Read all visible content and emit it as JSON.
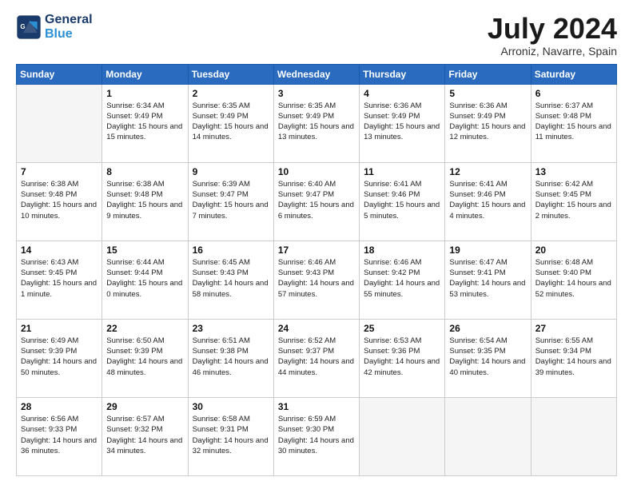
{
  "header": {
    "logo_line1": "General",
    "logo_line2": "Blue",
    "month_title": "July 2024",
    "location": "Arroniz, Navarre, Spain"
  },
  "days_of_week": [
    "Sunday",
    "Monday",
    "Tuesday",
    "Wednesday",
    "Thursday",
    "Friday",
    "Saturday"
  ],
  "weeks": [
    [
      {
        "day": "",
        "sunrise": "",
        "sunset": "",
        "daylight": ""
      },
      {
        "day": "1",
        "sunrise": "Sunrise: 6:34 AM",
        "sunset": "Sunset: 9:49 PM",
        "daylight": "Daylight: 15 hours and 15 minutes."
      },
      {
        "day": "2",
        "sunrise": "Sunrise: 6:35 AM",
        "sunset": "Sunset: 9:49 PM",
        "daylight": "Daylight: 15 hours and 14 minutes."
      },
      {
        "day": "3",
        "sunrise": "Sunrise: 6:35 AM",
        "sunset": "Sunset: 9:49 PM",
        "daylight": "Daylight: 15 hours and 13 minutes."
      },
      {
        "day": "4",
        "sunrise": "Sunrise: 6:36 AM",
        "sunset": "Sunset: 9:49 PM",
        "daylight": "Daylight: 15 hours and 13 minutes."
      },
      {
        "day": "5",
        "sunrise": "Sunrise: 6:36 AM",
        "sunset": "Sunset: 9:49 PM",
        "daylight": "Daylight: 15 hours and 12 minutes."
      },
      {
        "day": "6",
        "sunrise": "Sunrise: 6:37 AM",
        "sunset": "Sunset: 9:48 PM",
        "daylight": "Daylight: 15 hours and 11 minutes."
      }
    ],
    [
      {
        "day": "7",
        "sunrise": "Sunrise: 6:38 AM",
        "sunset": "Sunset: 9:48 PM",
        "daylight": "Daylight: 15 hours and 10 minutes."
      },
      {
        "day": "8",
        "sunrise": "Sunrise: 6:38 AM",
        "sunset": "Sunset: 9:48 PM",
        "daylight": "Daylight: 15 hours and 9 minutes."
      },
      {
        "day": "9",
        "sunrise": "Sunrise: 6:39 AM",
        "sunset": "Sunset: 9:47 PM",
        "daylight": "Daylight: 15 hours and 7 minutes."
      },
      {
        "day": "10",
        "sunrise": "Sunrise: 6:40 AM",
        "sunset": "Sunset: 9:47 PM",
        "daylight": "Daylight: 15 hours and 6 minutes."
      },
      {
        "day": "11",
        "sunrise": "Sunrise: 6:41 AM",
        "sunset": "Sunset: 9:46 PM",
        "daylight": "Daylight: 15 hours and 5 minutes."
      },
      {
        "day": "12",
        "sunrise": "Sunrise: 6:41 AM",
        "sunset": "Sunset: 9:46 PM",
        "daylight": "Daylight: 15 hours and 4 minutes."
      },
      {
        "day": "13",
        "sunrise": "Sunrise: 6:42 AM",
        "sunset": "Sunset: 9:45 PM",
        "daylight": "Daylight: 15 hours and 2 minutes."
      }
    ],
    [
      {
        "day": "14",
        "sunrise": "Sunrise: 6:43 AM",
        "sunset": "Sunset: 9:45 PM",
        "daylight": "Daylight: 15 hours and 1 minute."
      },
      {
        "day": "15",
        "sunrise": "Sunrise: 6:44 AM",
        "sunset": "Sunset: 9:44 PM",
        "daylight": "Daylight: 15 hours and 0 minutes."
      },
      {
        "day": "16",
        "sunrise": "Sunrise: 6:45 AM",
        "sunset": "Sunset: 9:43 PM",
        "daylight": "Daylight: 14 hours and 58 minutes."
      },
      {
        "day": "17",
        "sunrise": "Sunrise: 6:46 AM",
        "sunset": "Sunset: 9:43 PM",
        "daylight": "Daylight: 14 hours and 57 minutes."
      },
      {
        "day": "18",
        "sunrise": "Sunrise: 6:46 AM",
        "sunset": "Sunset: 9:42 PM",
        "daylight": "Daylight: 14 hours and 55 minutes."
      },
      {
        "day": "19",
        "sunrise": "Sunrise: 6:47 AM",
        "sunset": "Sunset: 9:41 PM",
        "daylight": "Daylight: 14 hours and 53 minutes."
      },
      {
        "day": "20",
        "sunrise": "Sunrise: 6:48 AM",
        "sunset": "Sunset: 9:40 PM",
        "daylight": "Daylight: 14 hours and 52 minutes."
      }
    ],
    [
      {
        "day": "21",
        "sunrise": "Sunrise: 6:49 AM",
        "sunset": "Sunset: 9:39 PM",
        "daylight": "Daylight: 14 hours and 50 minutes."
      },
      {
        "day": "22",
        "sunrise": "Sunrise: 6:50 AM",
        "sunset": "Sunset: 9:39 PM",
        "daylight": "Daylight: 14 hours and 48 minutes."
      },
      {
        "day": "23",
        "sunrise": "Sunrise: 6:51 AM",
        "sunset": "Sunset: 9:38 PM",
        "daylight": "Daylight: 14 hours and 46 minutes."
      },
      {
        "day": "24",
        "sunrise": "Sunrise: 6:52 AM",
        "sunset": "Sunset: 9:37 PM",
        "daylight": "Daylight: 14 hours and 44 minutes."
      },
      {
        "day": "25",
        "sunrise": "Sunrise: 6:53 AM",
        "sunset": "Sunset: 9:36 PM",
        "daylight": "Daylight: 14 hours and 42 minutes."
      },
      {
        "day": "26",
        "sunrise": "Sunrise: 6:54 AM",
        "sunset": "Sunset: 9:35 PM",
        "daylight": "Daylight: 14 hours and 40 minutes."
      },
      {
        "day": "27",
        "sunrise": "Sunrise: 6:55 AM",
        "sunset": "Sunset: 9:34 PM",
        "daylight": "Daylight: 14 hours and 39 minutes."
      }
    ],
    [
      {
        "day": "28",
        "sunrise": "Sunrise: 6:56 AM",
        "sunset": "Sunset: 9:33 PM",
        "daylight": "Daylight: 14 hours and 36 minutes."
      },
      {
        "day": "29",
        "sunrise": "Sunrise: 6:57 AM",
        "sunset": "Sunset: 9:32 PM",
        "daylight": "Daylight: 14 hours and 34 minutes."
      },
      {
        "day": "30",
        "sunrise": "Sunrise: 6:58 AM",
        "sunset": "Sunset: 9:31 PM",
        "daylight": "Daylight: 14 hours and 32 minutes."
      },
      {
        "day": "31",
        "sunrise": "Sunrise: 6:59 AM",
        "sunset": "Sunset: 9:30 PM",
        "daylight": "Daylight: 14 hours and 30 minutes."
      },
      {
        "day": "",
        "sunrise": "",
        "sunset": "",
        "daylight": ""
      },
      {
        "day": "",
        "sunrise": "",
        "sunset": "",
        "daylight": ""
      },
      {
        "day": "",
        "sunrise": "",
        "sunset": "",
        "daylight": ""
      }
    ]
  ]
}
